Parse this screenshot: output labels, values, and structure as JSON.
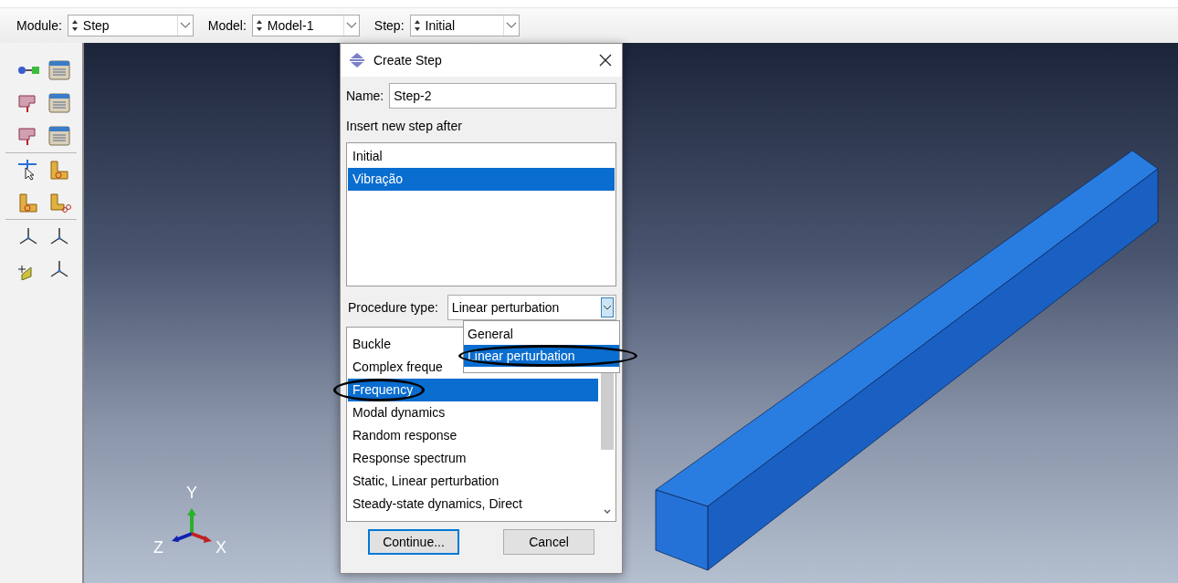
{
  "toolbar": {
    "fields": [
      {
        "label": "Module:",
        "value": "Step"
      },
      {
        "label": "Model:",
        "value": "Model-1"
      },
      {
        "label": "Step:",
        "value": "Initial"
      }
    ]
  },
  "dialog": {
    "title": "Create Step",
    "name_label": "Name:",
    "name_value": "Step-2",
    "insert_label": "Insert new step after",
    "steps": [
      {
        "label": "Initial",
        "selected": false
      },
      {
        "label": "Vibração",
        "selected": true
      }
    ],
    "procedure_label": "Procedure type:",
    "procedure_value": "Linear perturbation",
    "procedure_options": [
      {
        "label": "General",
        "selected": false,
        "circled": false
      },
      {
        "label": "Linear perturbation",
        "selected": true,
        "circled": true
      }
    ],
    "procedures": [
      {
        "label": "Buckle",
        "selected": false,
        "circled": false
      },
      {
        "label": "Complex freque",
        "selected": false,
        "circled": false
      },
      {
        "label": "Frequency",
        "selected": true,
        "circled": true
      },
      {
        "label": "Modal dynamics",
        "selected": false,
        "circled": false
      },
      {
        "label": "Random response",
        "selected": false,
        "circled": false
      },
      {
        "label": "Response spectrum",
        "selected": false,
        "circled": false
      },
      {
        "label": "Static, Linear perturbation",
        "selected": false,
        "circled": false
      },
      {
        "label": "Steady-state dynamics, Direct",
        "selected": false,
        "circled": false
      }
    ],
    "buttons": [
      {
        "label": "Continue...",
        "default": true
      },
      {
        "label": "Cancel",
        "default": false
      }
    ]
  },
  "triad": {
    "y": "Y",
    "z": "Z",
    "x": "X"
  }
}
